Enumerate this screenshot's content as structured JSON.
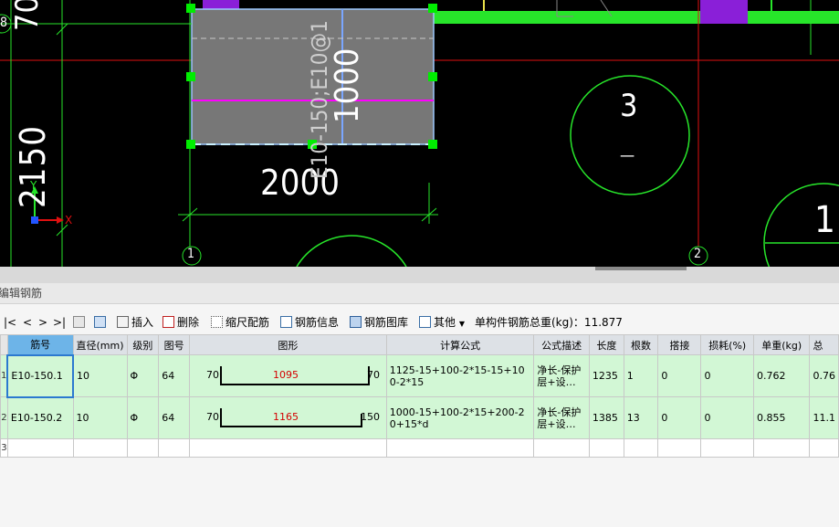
{
  "cad": {
    "dim_left": "2150",
    "dim_top_left": "70",
    "dim_bottom": "2000",
    "dim_vertical_label": "E10-150;E10@1",
    "dim_vertical_value": "1000",
    "axis_label_1": "1",
    "axis_label_2": "2",
    "axis_label_8": "8",
    "circle_label_big": "3",
    "circle_label_dash": "—",
    "circle_label_right": "1",
    "ucs_x": "X",
    "ucs_y": "Y",
    "colors": {
      "green": "#27e52a",
      "magenta": "#ff00ff",
      "purple": "#8a1fd8",
      "red": "#e01010",
      "gray": "#777777",
      "blue": "#7aa6ff"
    }
  },
  "panel": {
    "title": "编辑钢筋",
    "toolbar": {
      "nav_first": "|<",
      "nav_prev": "<",
      "nav_next": ">",
      "nav_last": ">|",
      "insert": "插入",
      "delete": "删除",
      "scale_config": "缩尺配筋",
      "rebar_info": "钢筋信息",
      "rebar_library": "钢筋图库",
      "other": "其他",
      "total_weight": "单构件钢筋总重(kg)：11.877"
    },
    "columns": [
      "筋号",
      "直径(mm)",
      "级别",
      "图号",
      "图形",
      "计算公式",
      "公式描述",
      "长度",
      "根数",
      "搭接",
      "损耗(%)",
      "单重(kg)",
      "总"
    ],
    "rows": [
      {
        "num": "1",
        "id": "E10-150.1",
        "diameter": "10",
        "grade": "Φ",
        "fig_no": "64",
        "shape_left": "70",
        "shape_mid": "1095",
        "shape_right": "70",
        "formula": "1125-15+100-2*15-15+100-2*15",
        "desc": "净长-保护层+设…",
        "length": "1235",
        "count": "1",
        "lap": "0",
        "loss": "0",
        "unit_weight": "0.762",
        "total": "0.76"
      },
      {
        "num": "2",
        "id": "E10-150.2",
        "diameter": "10",
        "grade": "Φ",
        "fig_no": "64",
        "shape_left": "70",
        "shape_mid": "1165",
        "shape_right": "150",
        "formula": "1000-15+100-2*15+200-20+15*d",
        "desc": "净长-保护层+设…",
        "length": "1385",
        "count": "13",
        "lap": "0",
        "loss": "0",
        "unit_weight": "0.855",
        "total": "11.1"
      }
    ],
    "empty_row_num": "3"
  }
}
